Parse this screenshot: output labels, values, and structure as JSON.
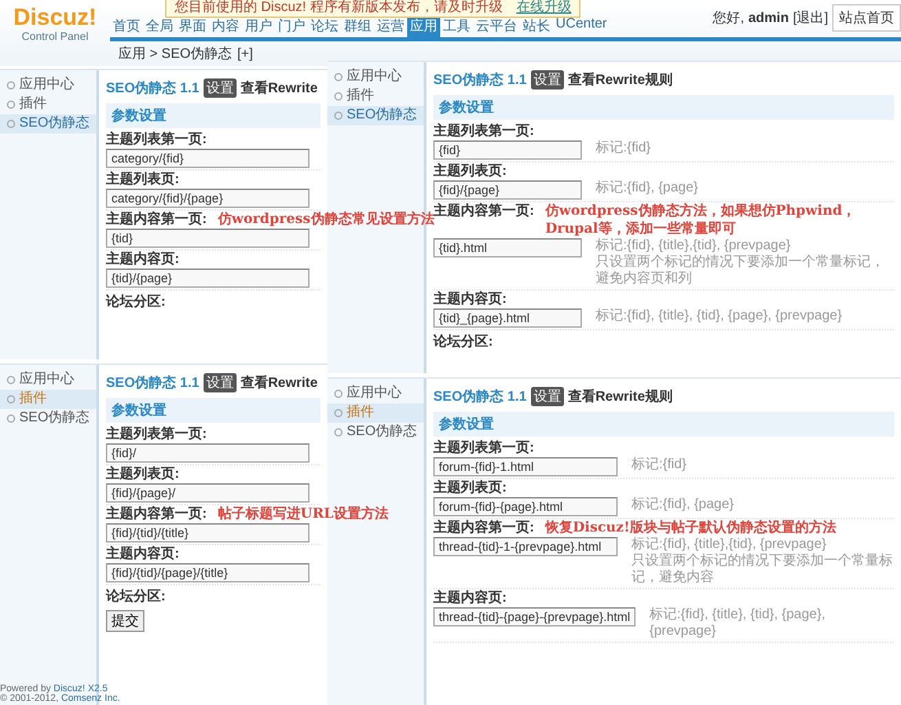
{
  "header": {
    "logo": "Discuz!",
    "subtitle": "Control Panel",
    "notice": "您目前使用的 Discuz! 程序有新版本发布，请及时升级",
    "notice_link": "在线升级",
    "nav": [
      {
        "label": "首页",
        "selected": false
      },
      {
        "label": "全局",
        "selected": false
      },
      {
        "label": "界面",
        "selected": false
      },
      {
        "label": "内容",
        "selected": false
      },
      {
        "label": "用户",
        "selected": false
      },
      {
        "label": "门户",
        "selected": false
      },
      {
        "label": "论坛",
        "selected": false
      },
      {
        "label": "群组",
        "selected": false
      },
      {
        "label": "运营",
        "selected": false
      },
      {
        "label": "应用",
        "selected": true
      },
      {
        "label": "工具",
        "selected": false
      },
      {
        "label": "云平台",
        "selected": false
      },
      {
        "label": "站长",
        "selected": false
      },
      {
        "label": "UCenter",
        "selected": false
      }
    ],
    "greeting": "您好,",
    "user": "admin",
    "logout": "[退出]",
    "site_home": "站点首页",
    "breadcrumb": "应用 > SEO伪静态",
    "breadcrumb_add": "[+]"
  },
  "panels": [
    {
      "sidebar": [
        {
          "label": "应用中心",
          "selected": false
        },
        {
          "label": "插件",
          "selected": false
        },
        {
          "label": "SEO伪静态",
          "selected": true
        }
      ],
      "title": "SEO伪静态 1.1",
      "settings_button": "设置",
      "rewrite_link": "查看Rewrite",
      "section": "参数设置",
      "fields": [
        {
          "label": "主题列表第一页:",
          "value": "category/{fid}"
        },
        {
          "label": "主题列表页:",
          "value": "category/{fid}/{page}"
        },
        {
          "label": "主题内容第一页:",
          "value": "{tid}",
          "note": "仿wordpress伪静态常见设置方法"
        },
        {
          "label": "主题内容页:",
          "value": "{tid}/{page}"
        }
      ],
      "last_label": "论坛分区:"
    },
    {
      "sidebar": [
        {
          "label": "应用中心",
          "selected": false
        },
        {
          "label": "插件",
          "selected": false
        },
        {
          "label": "SEO伪静态",
          "selected": true
        }
      ],
      "title": "SEO伪静态 1.1",
      "settings_button": "设置",
      "rewrite_link": "查看Rewrite规则",
      "section": "参数设置",
      "fields": [
        {
          "label": "主题列表第一页:",
          "value": "{fid}",
          "hints": [
            "标记:{fid}"
          ]
        },
        {
          "label": "主题列表页:",
          "value": "{fid}/{page}",
          "hints": [
            "标记:{fid}, {page}"
          ]
        },
        {
          "label": "主题内容第一页:",
          "value": "{tid}.html",
          "note": "仿wordpress伪静态方法，如果想仿Phpwind，Drupal等，添加一些常量即可",
          "hints": [
            "标记:{fid}, {title},{tid}, {prevpage}",
            "只设置两个标记的情况下要添加一个常量标记，避免内容页和列"
          ]
        },
        {
          "label": "主题内容页:",
          "value": "{tid}_{page}.html",
          "hints": [
            "标记:{fid}, {title}, {tid}, {page}, {prevpage}"
          ]
        }
      ],
      "last_label": "论坛分区:"
    },
    {
      "sidebar": [
        {
          "label": "应用中心",
          "selected": false
        },
        {
          "label": "插件",
          "selected": true
        },
        {
          "label": "SEO伪静态",
          "selected": false
        }
      ],
      "title": "SEO伪静态 1.1",
      "settings_button": "设置",
      "rewrite_link": "查看Rewrite",
      "section": "参数设置",
      "fields": [
        {
          "label": "主题列表第一页:",
          "value": "{fid}/"
        },
        {
          "label": "主题列表页:",
          "value": "{fid}/{page}/"
        },
        {
          "label": "主题内容第一页:",
          "value": "{fid}/{tid}/{title}",
          "note": "帖子标题写进URL设置方法"
        },
        {
          "label": "主题内容页:",
          "value": "{fid}/{tid}/{page}/{title}"
        }
      ],
      "last_label": "论坛分区:",
      "submit": "提交",
      "footer": {
        "powered": "Powered by",
        "powered_link": "Discuz! X2.5",
        "copyright": "© 2001-2012,",
        "company_link": "Comsenz Inc."
      }
    },
    {
      "sidebar": [
        {
          "label": "应用中心",
          "selected": false
        },
        {
          "label": "插件",
          "selected": true
        },
        {
          "label": "SEO伪静态",
          "selected": false
        }
      ],
      "title": "SEO伪静态 1.1",
      "settings_button": "设置",
      "rewrite_link": "查看Rewrite规则",
      "section": "参数设置",
      "fields": [
        {
          "label": "主题列表第一页:",
          "value": "forum-{fid}-1.html",
          "hints": [
            "标记:{fid}"
          ]
        },
        {
          "label": "主题列表页:",
          "value": "forum-{fid}-{page}.html",
          "hints": [
            "标记:{fid}, {page}"
          ]
        },
        {
          "label": "主题内容第一页:",
          "value": "thread-{tid}-1-{prevpage}.html",
          "note": "恢复Discuz!版块与帖子默认伪静态设置的方法",
          "hints": [
            "标记:{fid}, {title},{tid}, {prevpage}",
            "只设置两个标记的情况下要添加一个常量标记，避免内容"
          ]
        },
        {
          "label": "主题内容页:",
          "value": "thread-{tid}-{page}-{prevpage}.html",
          "hints": [
            "标记:{fid}, {title}, {tid}, {page}, {prevpage}"
          ]
        }
      ]
    }
  ]
}
